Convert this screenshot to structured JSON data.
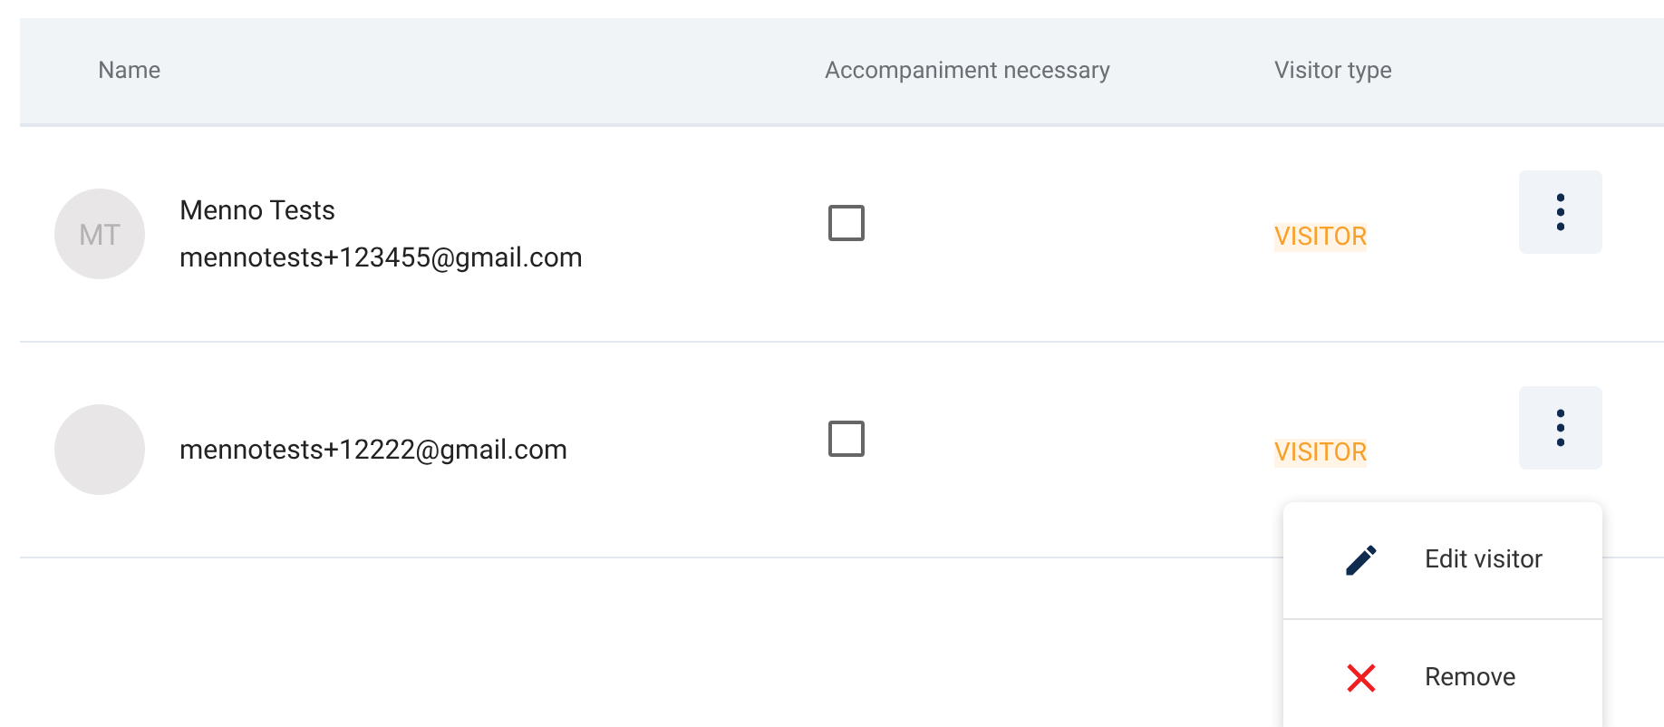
{
  "table": {
    "columns": [
      "Name",
      "Accompaniment necessary",
      "Visitor type"
    ],
    "rows": [
      {
        "initials": "MT",
        "name": "Menno Tests",
        "email": "mennotests+123455@gmail.com",
        "accompaniment": false,
        "type": "VISITOR"
      },
      {
        "email": "mennotests+12222@gmail.com",
        "accompaniment": false,
        "type": "VISITOR"
      }
    ]
  },
  "menu": {
    "items": [
      {
        "kind": "edit",
        "label": "Edit visitor"
      },
      {
        "kind": "remove",
        "label": "Remove"
      }
    ]
  }
}
